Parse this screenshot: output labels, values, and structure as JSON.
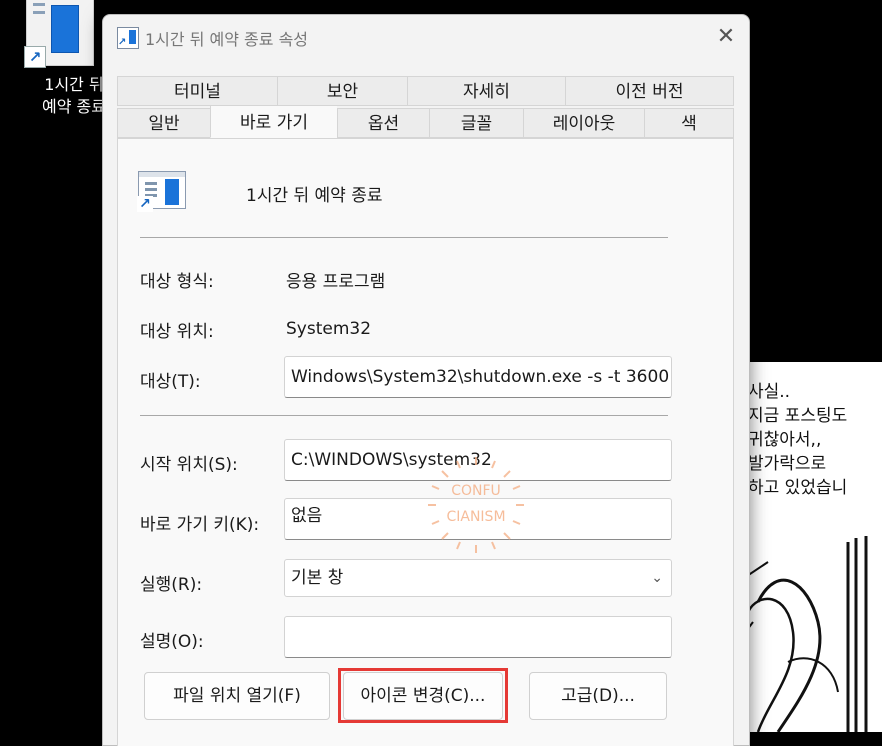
{
  "desktop": {
    "icon_label_line1": "1시간 뒤",
    "icon_label_line2": "예약 종료"
  },
  "comic": {
    "text": "사실..\n지금 포스팅도\n귀찮아서,,\n발가락으로\n하고 있었습니"
  },
  "dialog": {
    "title": "1시간 뒤 예약 종료 속성",
    "close_glyph": "✕",
    "tabs_row1": [
      "터미널",
      "보안",
      "자세히",
      "이전 버전"
    ],
    "tabs_row2": [
      "일반",
      "바로 가기",
      "옵션",
      "글꼴",
      "레이아웃",
      "색"
    ],
    "active_tab": "바로 가기",
    "shortcut_name": "1시간 뒤 예약 종료",
    "fields": {
      "target_type_label": "대상 형식:",
      "target_type_value": "응용 프로그램",
      "target_location_label": "대상 위치:",
      "target_location_value": "System32",
      "target_label": "대상(T):",
      "target_value": "Windows\\System32\\shutdown.exe -s -t 3600",
      "start_in_label": "시작 위치(S):",
      "start_in_value": "C:\\WINDOWS\\system32",
      "shortcut_key_label": "바로 가기 키(K):",
      "shortcut_key_value": "없음",
      "run_label": "실행(R):",
      "run_value": "기본 창",
      "comment_label": "설명(O):",
      "comment_value": ""
    },
    "buttons": {
      "open_location": "파일 위치 열기(F)",
      "change_icon": "아이콘 변경(C)...",
      "advanced": "고급(D)..."
    },
    "watermark": {
      "line1": "CONFU",
      "line2": "CIANISM"
    },
    "colors": {
      "highlight": "#e53935",
      "accent": "#1a73d9"
    }
  }
}
